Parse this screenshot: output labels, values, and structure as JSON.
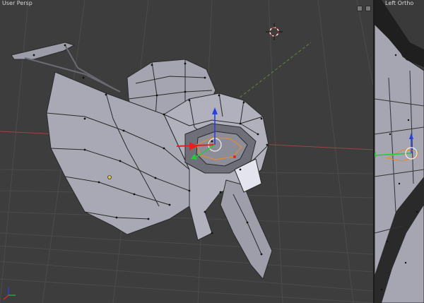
{
  "viewports": {
    "main": {
      "label": "User Persp"
    },
    "side": {
      "label": "Left Ortho"
    }
  },
  "colors": {
    "background": "#3d3d3d",
    "grid": "#4a4a4a",
    "axis_x": "#b64a4a",
    "axis_y": "#6e9a45",
    "mesh_face": "#a7a7b3",
    "mesh_face_dark": "#8c8c97",
    "mesh_edge": "#2a2a2a",
    "selection": "#e38a2e",
    "manipulator_x": "#e42020",
    "manipulator_y": "#22cc33",
    "manipulator_z": "#2a3fe0"
  },
  "icons": [
    "3d-cursor-icon",
    "transform-manipulator-icon",
    "viewport-split-icon"
  ]
}
